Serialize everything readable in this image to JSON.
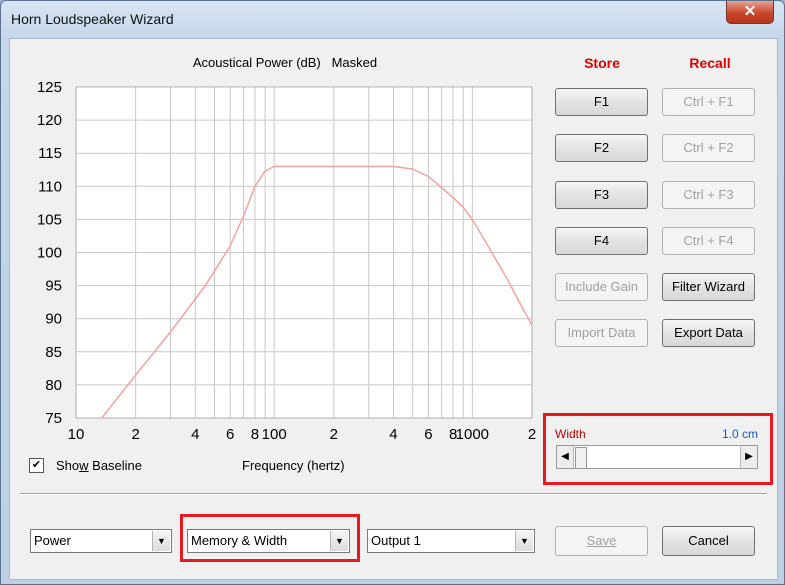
{
  "window": {
    "title": "Horn Loudspeaker Wizard",
    "close_glyph": "✕"
  },
  "chart_header": "Acoustical Power (dB)   Masked",
  "columns": {
    "store": "Store",
    "recall": "Recall"
  },
  "buttons": {
    "f1": "F1",
    "f2": "F2",
    "f3": "F3",
    "f4": "F4",
    "ctrl_f1": "Ctrl + F1",
    "ctrl_f2": "Ctrl + F2",
    "ctrl_f3": "Ctrl + F3",
    "ctrl_f4": "Ctrl + F4",
    "include_gain": "Include Gain",
    "filter_wizard": "Filter Wizard",
    "import_data": "Import Data",
    "export_data": "Export Data",
    "save": "Save",
    "cancel": "Cancel"
  },
  "slider": {
    "label": "Width",
    "value": "1.0 cm",
    "left_arrow": "◀",
    "right_arrow": "▶",
    "level": 0.0
  },
  "show_baseline": {
    "prefix": "Sho",
    "underline": "w",
    "suffix": " Baseline",
    "checked": true,
    "check_glyph": "✔"
  },
  "dropdowns": {
    "power": "Power",
    "memory_width": "Memory & Width",
    "output": "Output 1",
    "arrow_glyph": "▼"
  },
  "chart_data": {
    "type": "line",
    "xlabel": "Frequency (hertz)",
    "ylabel": "",
    "xscale": "log",
    "xlim": [
      10,
      2000
    ],
    "ylim": [
      75,
      125
    ],
    "grid": true,
    "yticks": [
      "125",
      "120",
      "115",
      "110",
      "105",
      "100",
      "95",
      "90",
      "85",
      "80",
      "75"
    ],
    "xticks": [
      "10",
      "2",
      "4",
      "6",
      "8",
      "100",
      "2",
      "4",
      "6",
      "8",
      "1000",
      "2"
    ],
    "series": [
      {
        "color": "#f4a7a0",
        "x": [
          13.5,
          20,
          30,
          45,
          60,
          70,
          80,
          90,
          100,
          150,
          200,
          300,
          400,
          500,
          600,
          700,
          800,
          900,
          1000,
          1200,
          1500,
          1800,
          2000
        ],
        "y": [
          75,
          81.5,
          88,
          95,
          101,
          105.5,
          110,
          112.3,
          113,
          113,
          113,
          113,
          113,
          112.6,
          111.5,
          109.8,
          108.3,
          106.8,
          105,
          101,
          96,
          91.5,
          89
        ]
      }
    ]
  }
}
